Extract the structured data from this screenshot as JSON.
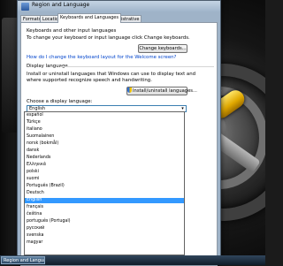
{
  "window": {
    "title": "Region and Language"
  },
  "tabs": [
    {
      "label": "Formats",
      "active": false
    },
    {
      "label": "Location",
      "active": false
    },
    {
      "label": "Keyboards and Languages",
      "active": true
    },
    {
      "label": "Administrative",
      "active": false
    }
  ],
  "keyboards": {
    "heading": "Keyboards and other input languages",
    "description": "To change your keyboard or input language click Change keyboards.",
    "button_label": "Change keyboards...",
    "link_text": "How do I change the keyboard layout for the Welcome screen?"
  },
  "display_language": {
    "heading": "Display language",
    "description_line1": "Install or uninstall languages that Windows can use to display text and",
    "description_line2": "where supported recognize speech and handwriting.",
    "button_label": "Install/uninstall languages...",
    "choose_label": "Choose a display language:",
    "selected_value": "English"
  },
  "dropdown": {
    "items": [
      "español",
      "Türkçe",
      "italiano",
      "Suomalainen",
      "norsk (bokmål)",
      "dansk",
      "Nederlands",
      "Ελληνικά",
      "polski",
      "suomi",
      "Português (Brazil)",
      "Deutsch",
      "English",
      "français",
      "čeština",
      "português (Portugal)",
      "русский",
      "svenska",
      "magyar"
    ],
    "selected_index": 12
  },
  "taskbar": {
    "button_label": "Region and Language"
  },
  "colors": {
    "selection": "#3399ff",
    "link": "#0044cc",
    "accent_handle": "#f2c400"
  }
}
